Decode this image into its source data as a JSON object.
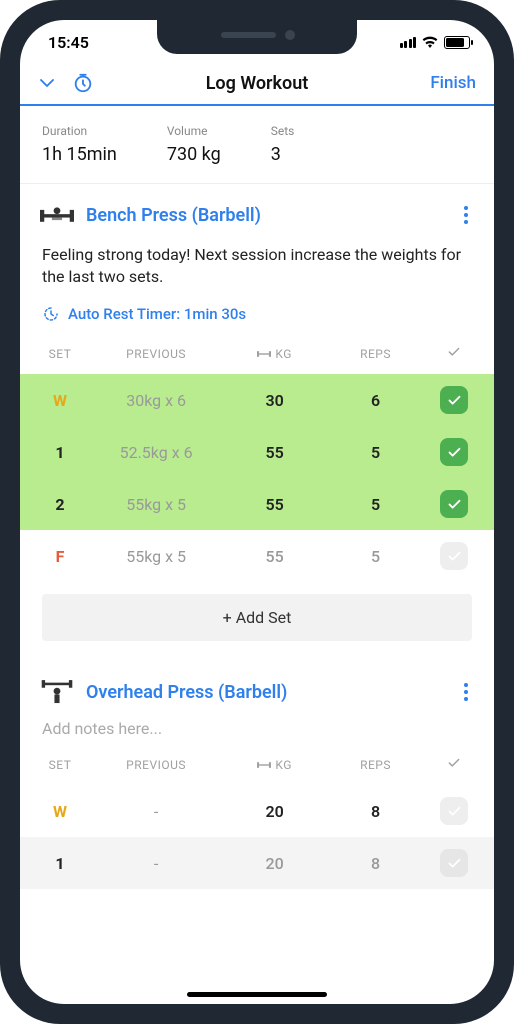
{
  "status": {
    "time": "15:45"
  },
  "nav": {
    "title": "Log Workout",
    "finish": "Finish"
  },
  "summary": {
    "duration_label": "Duration",
    "duration": "1h 15min",
    "volume_label": "Volume",
    "volume": "730 kg",
    "sets_label": "Sets",
    "sets": "3"
  },
  "exercises": [
    {
      "title": "Bench Press (Barbell)",
      "note": "Feeling strong today! Next session increase the weights for the last two sets.",
      "rest": "Auto Rest Timer: 1min 30s",
      "headers": {
        "set": "SET",
        "previous": "PREVIOUS",
        "kg": "KG",
        "reps": "REPS"
      },
      "rows": [
        {
          "label": "W",
          "type": "warm",
          "prev": "30kg x 6",
          "kg": "30",
          "reps": "6",
          "done": true
        },
        {
          "label": "1",
          "type": "normal",
          "prev": "52.5kg x 6",
          "kg": "55",
          "reps": "5",
          "done": true
        },
        {
          "label": "2",
          "type": "normal",
          "prev": "55kg x 5",
          "kg": "55",
          "reps": "5",
          "done": true
        },
        {
          "label": "F",
          "type": "fail",
          "prev": "55kg x 5",
          "kg": "55",
          "reps": "5",
          "done": false
        }
      ],
      "add_set": "+ Add Set"
    },
    {
      "title": "Overhead Press (Barbell)",
      "placeholder": "Add notes here...",
      "headers": {
        "set": "SET",
        "previous": "PREVIOUS",
        "kg": "KG",
        "reps": "REPS"
      },
      "rows": [
        {
          "label": "W",
          "type": "warm",
          "prev": "-",
          "kg": "20",
          "reps": "8",
          "done": false
        },
        {
          "label": "1",
          "type": "grey",
          "prev": "-",
          "kg": "20",
          "reps": "8",
          "done": false
        }
      ]
    }
  ]
}
